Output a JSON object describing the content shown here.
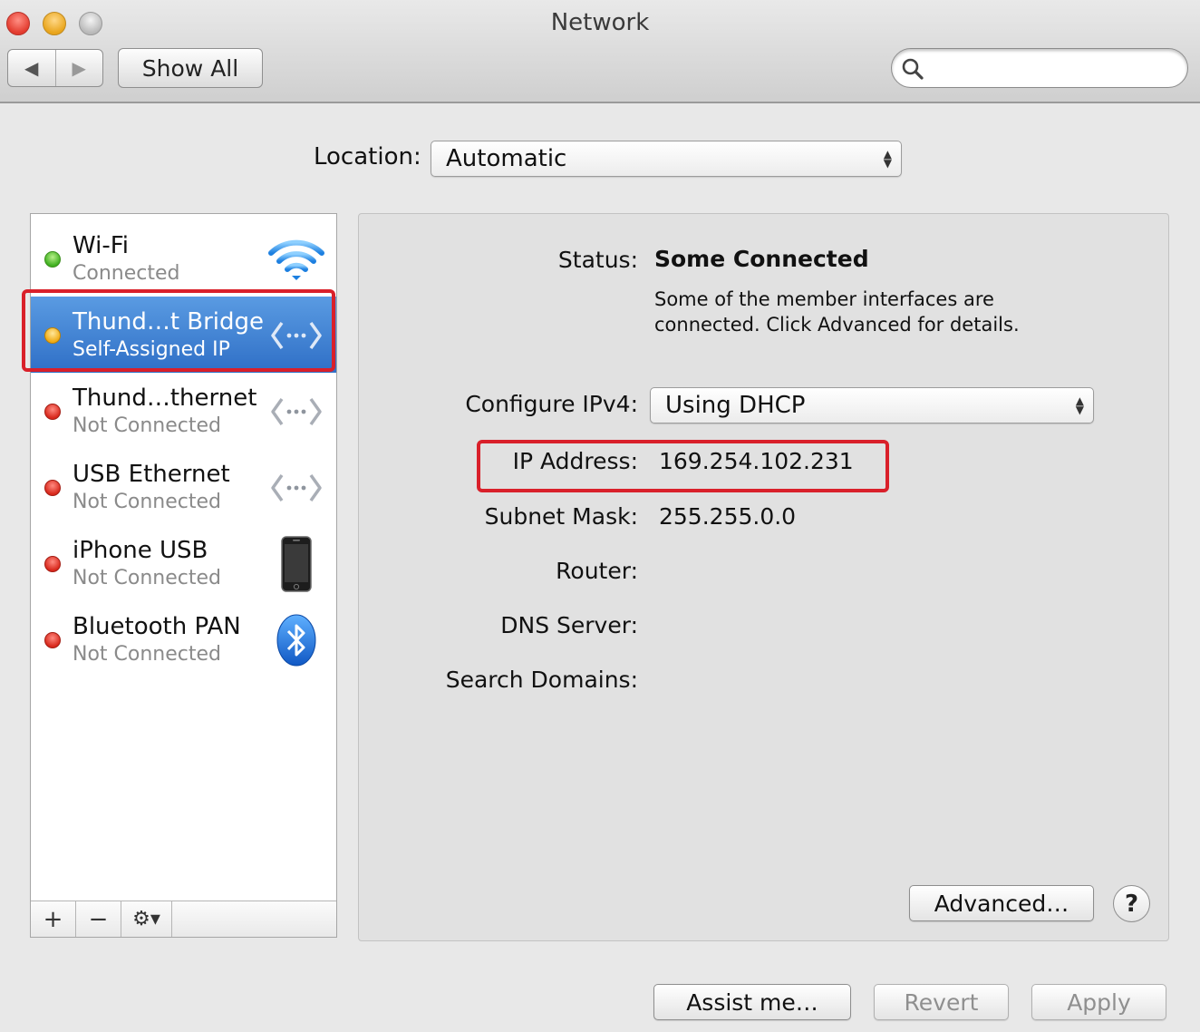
{
  "window": {
    "title": "Network"
  },
  "toolbar": {
    "back_glyph": "◀",
    "forward_glyph": "▶",
    "show_all_label": "Show All",
    "search_value": "",
    "search_placeholder": ""
  },
  "location": {
    "label": "Location:",
    "value": "Automatic"
  },
  "services": [
    {
      "name": "Wi-Fi",
      "status": "Connected",
      "status_color": "green",
      "icon": "wifi-icon"
    },
    {
      "name": "Thund…t Bridge",
      "status": "Self-Assigned IP",
      "status_color": "yellow",
      "icon": "ethernet-arrows-icon",
      "selected": true
    },
    {
      "name": "Thund…thernet",
      "status": "Not Connected",
      "status_color": "red",
      "icon": "ethernet-arrows-icon"
    },
    {
      "name": "USB Ethernet",
      "status": "Not Connected",
      "status_color": "red",
      "icon": "ethernet-arrows-icon"
    },
    {
      "name": "iPhone USB",
      "status": "Not Connected",
      "status_color": "red",
      "icon": "iphone-icon"
    },
    {
      "name": "Bluetooth PAN",
      "status": "Not Connected",
      "status_color": "red",
      "icon": "bluetooth-icon"
    }
  ],
  "sidebar_footer": {
    "add": "+",
    "remove": "−",
    "action": "⚙▾"
  },
  "detail": {
    "status_label": "Status:",
    "status_value": "Some Connected",
    "status_desc_line1": "Some of the member interfaces are",
    "status_desc_line2": "connected. Click Advanced for details.",
    "configure_label": "Configure IPv4:",
    "configure_value": "Using DHCP",
    "ip_label": "IP Address:",
    "ip_value": "169.254.102.231",
    "subnet_label": "Subnet Mask:",
    "subnet_value": "255.255.0.0",
    "router_label": "Router:",
    "router_value": "",
    "dns_label": "DNS Server:",
    "dns_value": "",
    "search_domains_label": "Search Domains:",
    "search_domains_value": "",
    "advanced_label": "Advanced…",
    "help_label": "?"
  },
  "footer": {
    "assist_label": "Assist me…",
    "revert_label": "Revert",
    "apply_label": "Apply"
  },
  "colors": {
    "annotation": "#d9202a",
    "selection": "#3a7fd4",
    "status_green": "#3fb020",
    "status_yellow": "#f0ab14",
    "status_red": "#d8281c"
  }
}
